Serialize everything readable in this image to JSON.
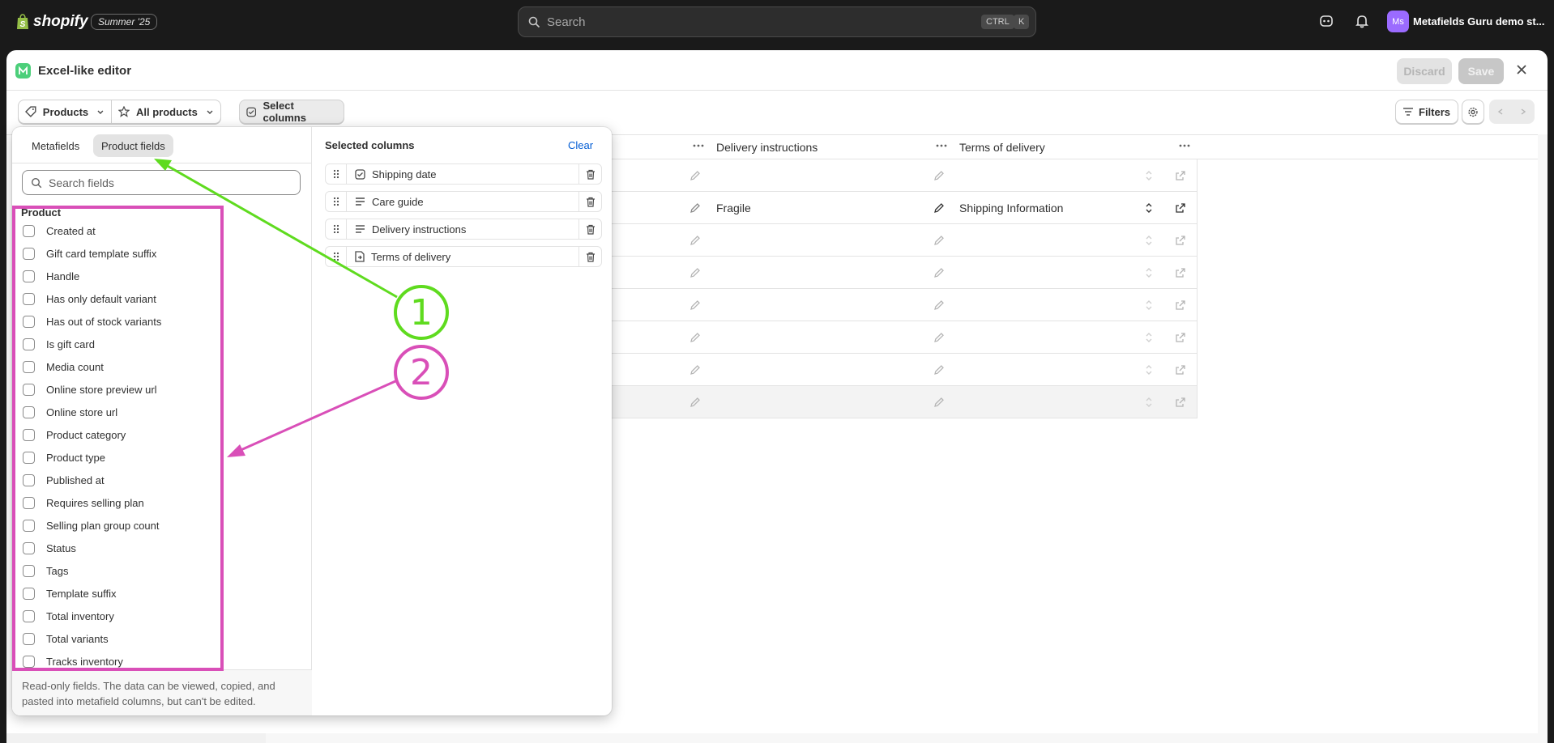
{
  "topbar": {
    "brand": "shopify",
    "edition_badge": "Summer '25",
    "search_placeholder": "Search",
    "shortcut_keys": [
      "CTRL",
      "K"
    ],
    "avatar_initials": "Ms",
    "store_name": "Metafields Guru demo st..."
  },
  "modal": {
    "title": "Excel-like editor",
    "discard_label": "Discard",
    "save_label": "Save"
  },
  "toolbar": {
    "resource_label": "Products",
    "filter_preset_label": "All products",
    "select_columns_label": "Select columns",
    "filters_label": "Filters"
  },
  "grid": {
    "columns": [
      "Delivery instructions",
      "Terms of delivery"
    ],
    "rows": [
      {
        "delivery_instructions": "",
        "terms_of_delivery": ""
      },
      {
        "delivery_instructions": "Fragile",
        "terms_of_delivery": "Shipping Information"
      },
      {
        "delivery_instructions": "",
        "terms_of_delivery": ""
      },
      {
        "delivery_instructions": "",
        "terms_of_delivery": ""
      },
      {
        "delivery_instructions": "",
        "terms_of_delivery": ""
      },
      {
        "delivery_instructions": "",
        "terms_of_delivery": ""
      },
      {
        "delivery_instructions": "",
        "terms_of_delivery": ""
      },
      {
        "delivery_instructions": "",
        "terms_of_delivery": ""
      }
    ]
  },
  "column_picker": {
    "tabs": [
      "Metafields",
      "Product fields"
    ],
    "active_tab": "Product fields",
    "search_placeholder": "Search fields",
    "group_title": "Product",
    "fields": [
      "Created at",
      "Gift card template suffix",
      "Handle",
      "Has only default variant",
      "Has out of stock variants",
      "Is gift card",
      "Media count",
      "Online store preview url",
      "Online store url",
      "Product category",
      "Product type",
      "Published at",
      "Requires selling plan",
      "Selling plan group count",
      "Status",
      "Tags",
      "Template suffix",
      "Total inventory",
      "Total variants",
      "Tracks inventory"
    ],
    "footer_note": "Read-only fields. The data can be viewed, copied, and pasted into metafield columns, but can't be edited.",
    "selected_title": "Selected columns",
    "clear_label": "Clear",
    "selected": [
      {
        "label": "Shipping date",
        "icon": "calendar-check-icon"
      },
      {
        "label": "Care guide",
        "icon": "text-lines-icon"
      },
      {
        "label": "Delivery instructions",
        "icon": "text-lines-icon"
      },
      {
        "label": "Terms of delivery",
        "icon": "page-reference-icon"
      }
    ]
  },
  "annotations": {
    "callout_1": "1",
    "callout_2": "2",
    "colors": {
      "callout_1": "#5fdb1f",
      "callout_2": "#d94fb8"
    }
  }
}
